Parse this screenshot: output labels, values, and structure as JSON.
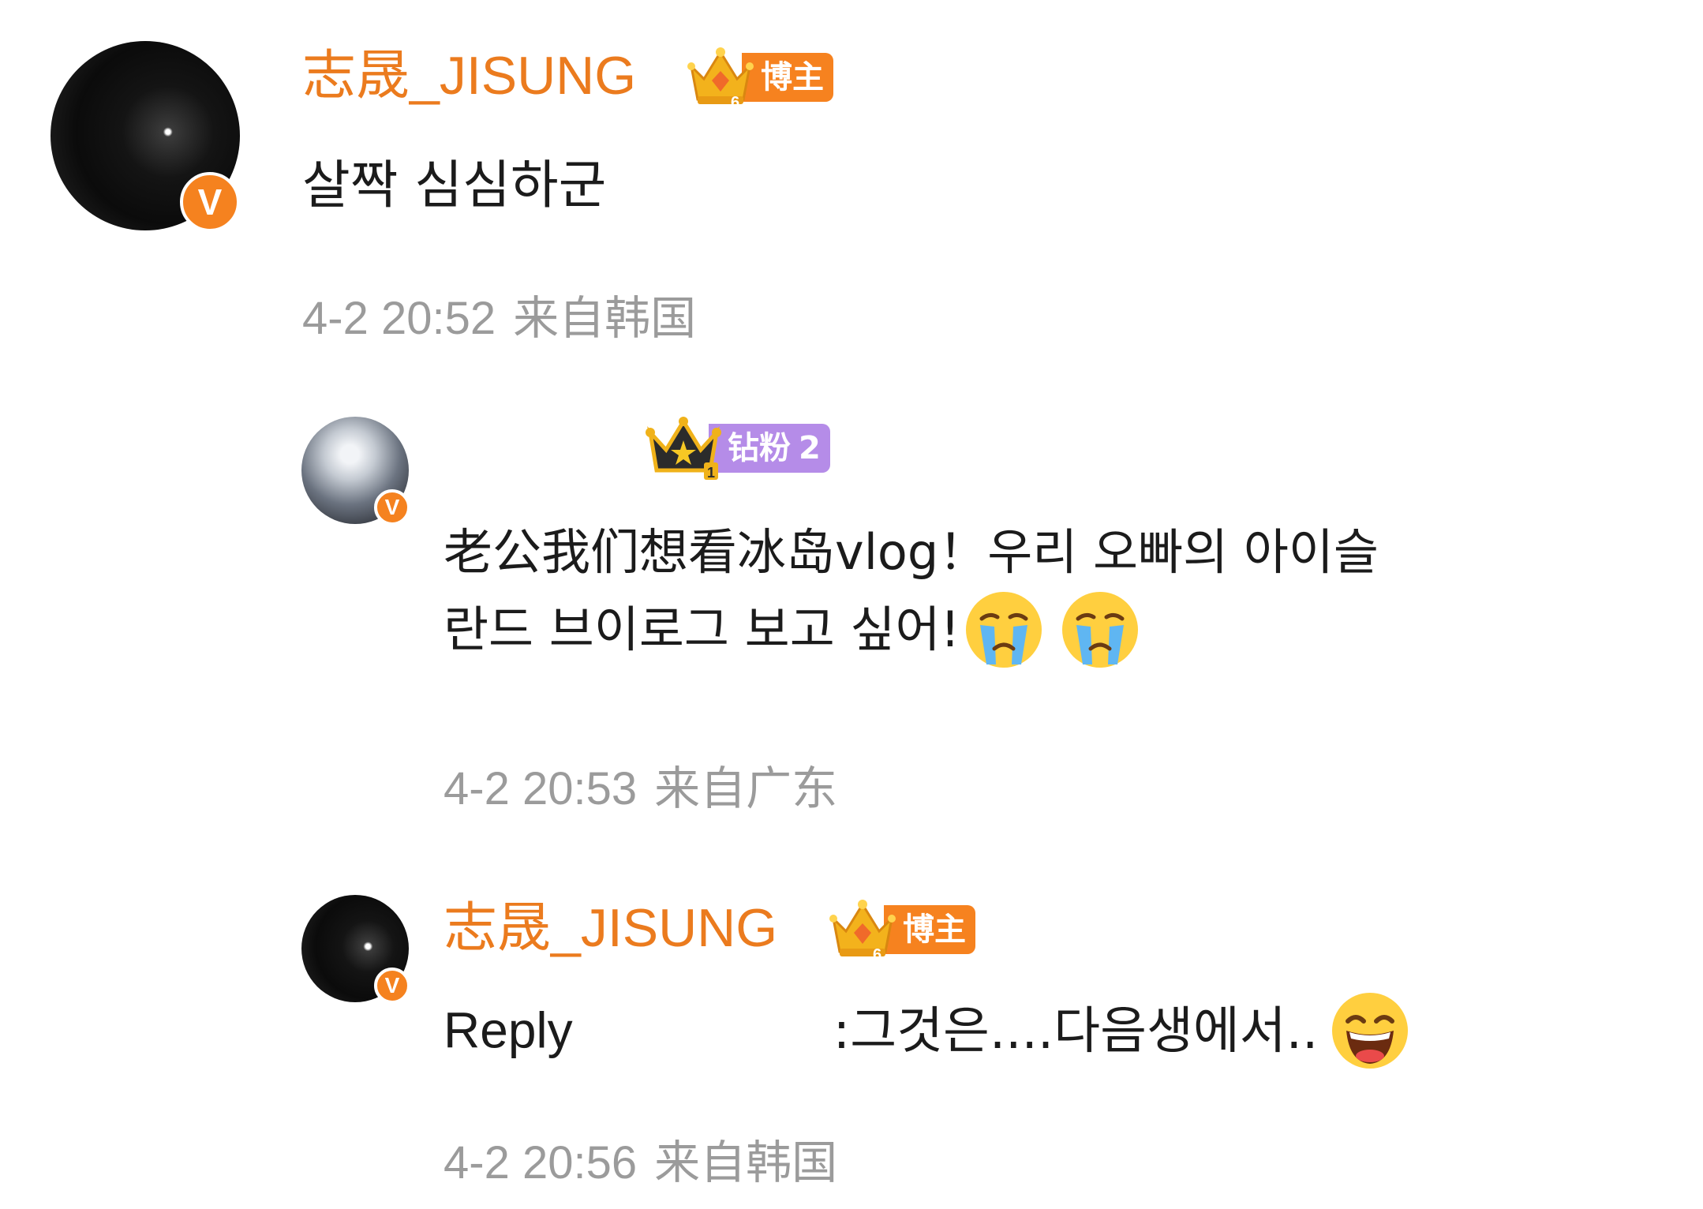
{
  "comments": [
    {
      "username": "志晟_JISUNG",
      "badge_label": "博主",
      "badge_level": "6",
      "text": "살짝 심심하군",
      "time": "4-2 20:52",
      "location": "来自韩国"
    },
    {
      "username": "",
      "badge_label": "钻粉",
      "badge_level": "2",
      "crown_level": "1",
      "text_line1": "老公我们想看冰岛vlog！우리 오빠의 아이슬",
      "text_line2": "란드 브이로그 보고 싶어!",
      "emoji": [
        "crying-emoji",
        "crying-emoji"
      ],
      "time": "4-2 20:53",
      "location": "来自广东"
    },
    {
      "username": "志晟_JISUNG",
      "badge_label": "博主",
      "badge_level": "6",
      "reply_label": "Reply",
      "text": ":그것은....다음생에서..",
      "emoji": [
        "laughing-emoji"
      ],
      "time": "4-2 20:56",
      "location": "来自韩国"
    }
  ],
  "colors": {
    "username": "#eb7b1e",
    "blogger_badge": "#f6821f",
    "fan_badge": "#b58ce8",
    "verified_badge": "#f5821f",
    "meta_text": "#9b9b9b",
    "comment_text": "#1b1b1b"
  }
}
